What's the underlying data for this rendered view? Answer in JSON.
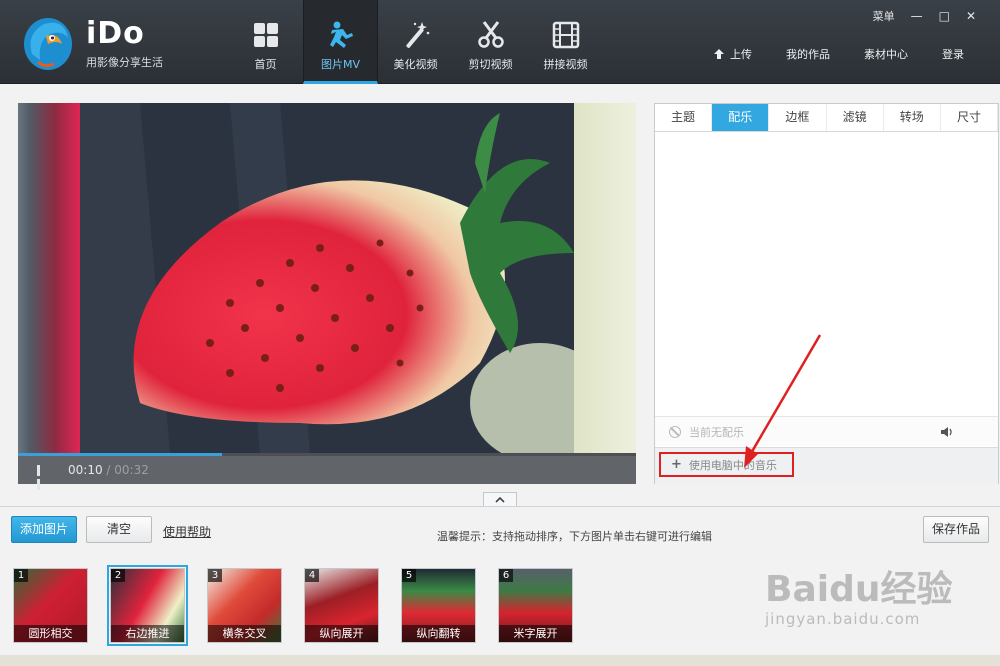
{
  "app": {
    "name": "iDo",
    "slogan": "用影像分享生活"
  },
  "nav": [
    {
      "label": "首页",
      "icon": "grid-icon"
    },
    {
      "label": "图片MV",
      "icon": "runner-icon",
      "active": true
    },
    {
      "label": "美化视频",
      "icon": "magic-wand-icon"
    },
    {
      "label": "剪切视频",
      "icon": "scissors-icon"
    },
    {
      "label": "拼接视频",
      "icon": "film-strip-icon"
    }
  ],
  "window": {
    "menu_label": "菜单",
    "minimize": "—",
    "maximize": "□",
    "close": "✕"
  },
  "toplinks": {
    "upload": "上传",
    "my_works": "我的作品",
    "material_center": "素材中心",
    "login": "登录"
  },
  "player": {
    "current_time": "00:10",
    "separator": " / ",
    "duration": "00:32",
    "progress": 0.33
  },
  "panel": {
    "tabs": [
      "主题",
      "配乐",
      "边框",
      "滤镜",
      "转场",
      "尺寸"
    ],
    "active_tab": "配乐",
    "no_music": "当前无配乐",
    "add_music": "使用电脑中的音乐"
  },
  "toolbar": {
    "add_images": "添加图片",
    "clear": "清空",
    "help": "使用帮助",
    "tip": "温馨提示：支持拖动排序，下方图片单击右键可进行编辑",
    "save": "保存作品"
  },
  "thumbnails": [
    {
      "index": "1",
      "label": "圆形相交"
    },
    {
      "index": "2",
      "label": "右边推进",
      "selected": true
    },
    {
      "index": "3",
      "label": "横条交叉"
    },
    {
      "index": "4",
      "label": "纵向展开"
    },
    {
      "index": "5",
      "label": "纵向翻转"
    },
    {
      "index": "6",
      "label": "米字展开"
    }
  ],
  "watermark": {
    "line1": "Baidu经验",
    "line2": "jingyan.baidu.com"
  },
  "colors": {
    "accent": "#2ea7e0",
    "header": "#30353b",
    "highlight": "#e02020"
  }
}
